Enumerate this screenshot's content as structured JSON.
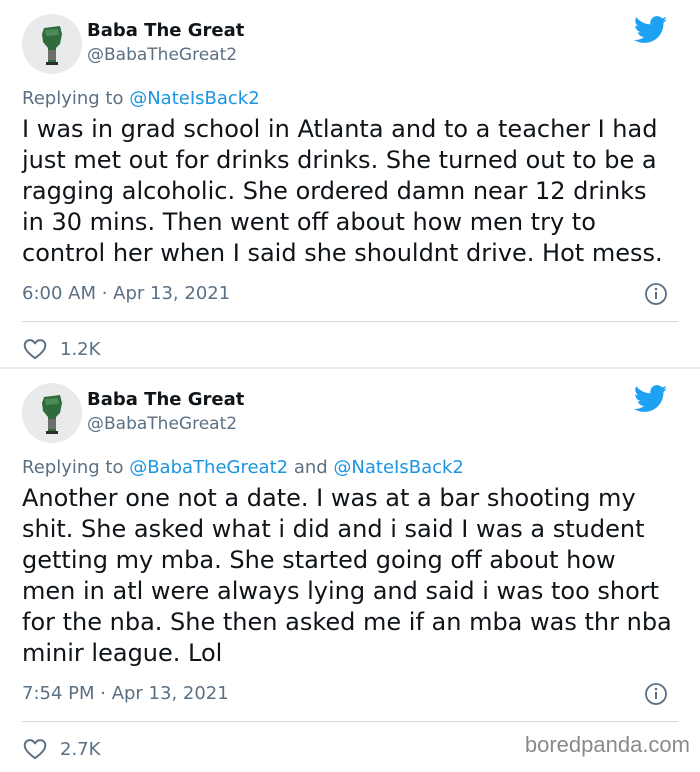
{
  "tweets": [
    {
      "name": "Baba The Great",
      "handle": "@BabaTheGreat2",
      "reply_prefix": "Replying to ",
      "reply_mentions": [
        "@NateIsBack2"
      ],
      "reply_joiner": "",
      "text": "I was in grad school in Atlanta and to a teacher I had\njust met out for drinks drinks. She turned out to be a\nragging alcoholic. She ordered damn near 12 drinks\nin 30 mins. Then went off about how men try to\ncontrol her when I said she shouldnt drive. Hot mess.",
      "timestamp": "6:00 AM · Apr 13, 2021",
      "likes": "1.2K"
    },
    {
      "name": "Baba The Great",
      "handle": "@BabaTheGreat2",
      "reply_prefix": "Replying to ",
      "reply_mentions": [
        "@BabaTheGreat2",
        "@NateIsBack2"
      ],
      "reply_joiner": " and ",
      "text": "Another one not a date. I was at a bar shooting my\nshit. She asked  what i did and i said I was a student\ngetting  my mba. She started going off about how\nmen in atl were always lying and said i was too short\nfor the nba. She then asked me if an mba was thr nba\nminir league. Lol",
      "timestamp": "7:54 PM · Apr 13, 2021",
      "likes": "2.7K"
    }
  ],
  "icons": {
    "avatar": "raised-fist-avatar",
    "platform": "twitter-bird-icon",
    "info": "info-icon",
    "like": "heart-icon"
  },
  "colors": {
    "brand": "#1da1f2",
    "mention": "#1b95e0",
    "secondary_text": "#5b7083"
  },
  "watermark": "boredpanda.com"
}
